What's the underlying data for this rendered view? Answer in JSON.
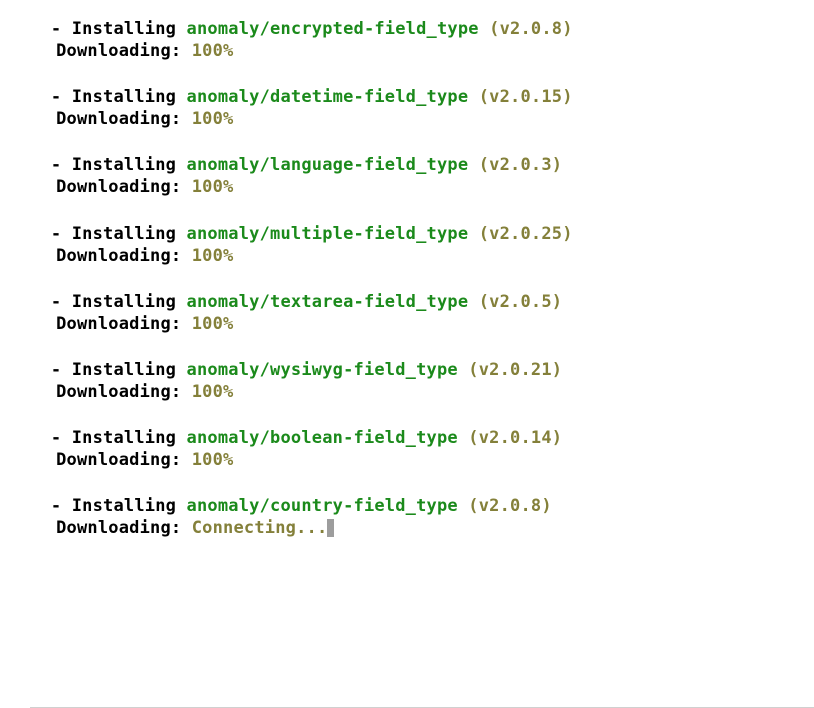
{
  "strings": {
    "dash": "  - ",
    "installing": "Installing ",
    "downloading": "Downloading: ",
    "space": " "
  },
  "entries": [
    {
      "package": "anomaly/encrypted-field_type",
      "version": "(v2.0.8)",
      "status": "100%",
      "cursor": false
    },
    {
      "package": "anomaly/datetime-field_type",
      "version": "(v2.0.15)",
      "status": "100%",
      "cursor": false
    },
    {
      "package": "anomaly/language-field_type",
      "version": "(v2.0.3)",
      "status": "100%",
      "cursor": false
    },
    {
      "package": "anomaly/multiple-field_type",
      "version": "(v2.0.25)",
      "status": "100%",
      "cursor": false
    },
    {
      "package": "anomaly/textarea-field_type",
      "version": "(v2.0.5)",
      "status": "100%",
      "cursor": false
    },
    {
      "package": "anomaly/wysiwyg-field_type",
      "version": "(v2.0.21)",
      "status": "100%",
      "cursor": false
    },
    {
      "package": "anomaly/boolean-field_type",
      "version": "(v2.0.14)",
      "status": "100%",
      "cursor": false
    },
    {
      "package": "anomaly/country-field_type",
      "version": "(v2.0.8)",
      "status": "Connecting...",
      "cursor": true
    }
  ]
}
